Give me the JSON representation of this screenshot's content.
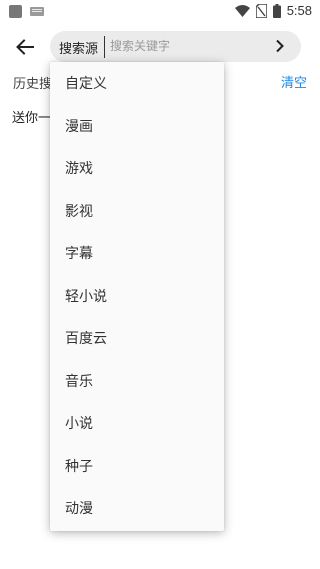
{
  "status_bar": {
    "time": "5:58",
    "icons": [
      "app-square-icon",
      "keyboard-icon",
      "wifi-icon",
      "no-sim-icon",
      "battery-icon"
    ]
  },
  "search": {
    "source_label": "搜索源",
    "placeholder": "搜索关键字",
    "value": ""
  },
  "history": {
    "title": "历史搜索",
    "clear_label": "清空",
    "items": [
      "送你一朵小红花"
    ]
  },
  "dropdown": {
    "items": [
      "自定义",
      "漫画",
      "游戏",
      "影视",
      "字幕",
      "轻小说",
      "百度云",
      "音乐",
      "小说",
      "种子",
      "动漫"
    ]
  },
  "colors": {
    "accent": "#1e88e5",
    "search_bg": "#ebebeb",
    "dropdown_bg": "#fafafa"
  }
}
